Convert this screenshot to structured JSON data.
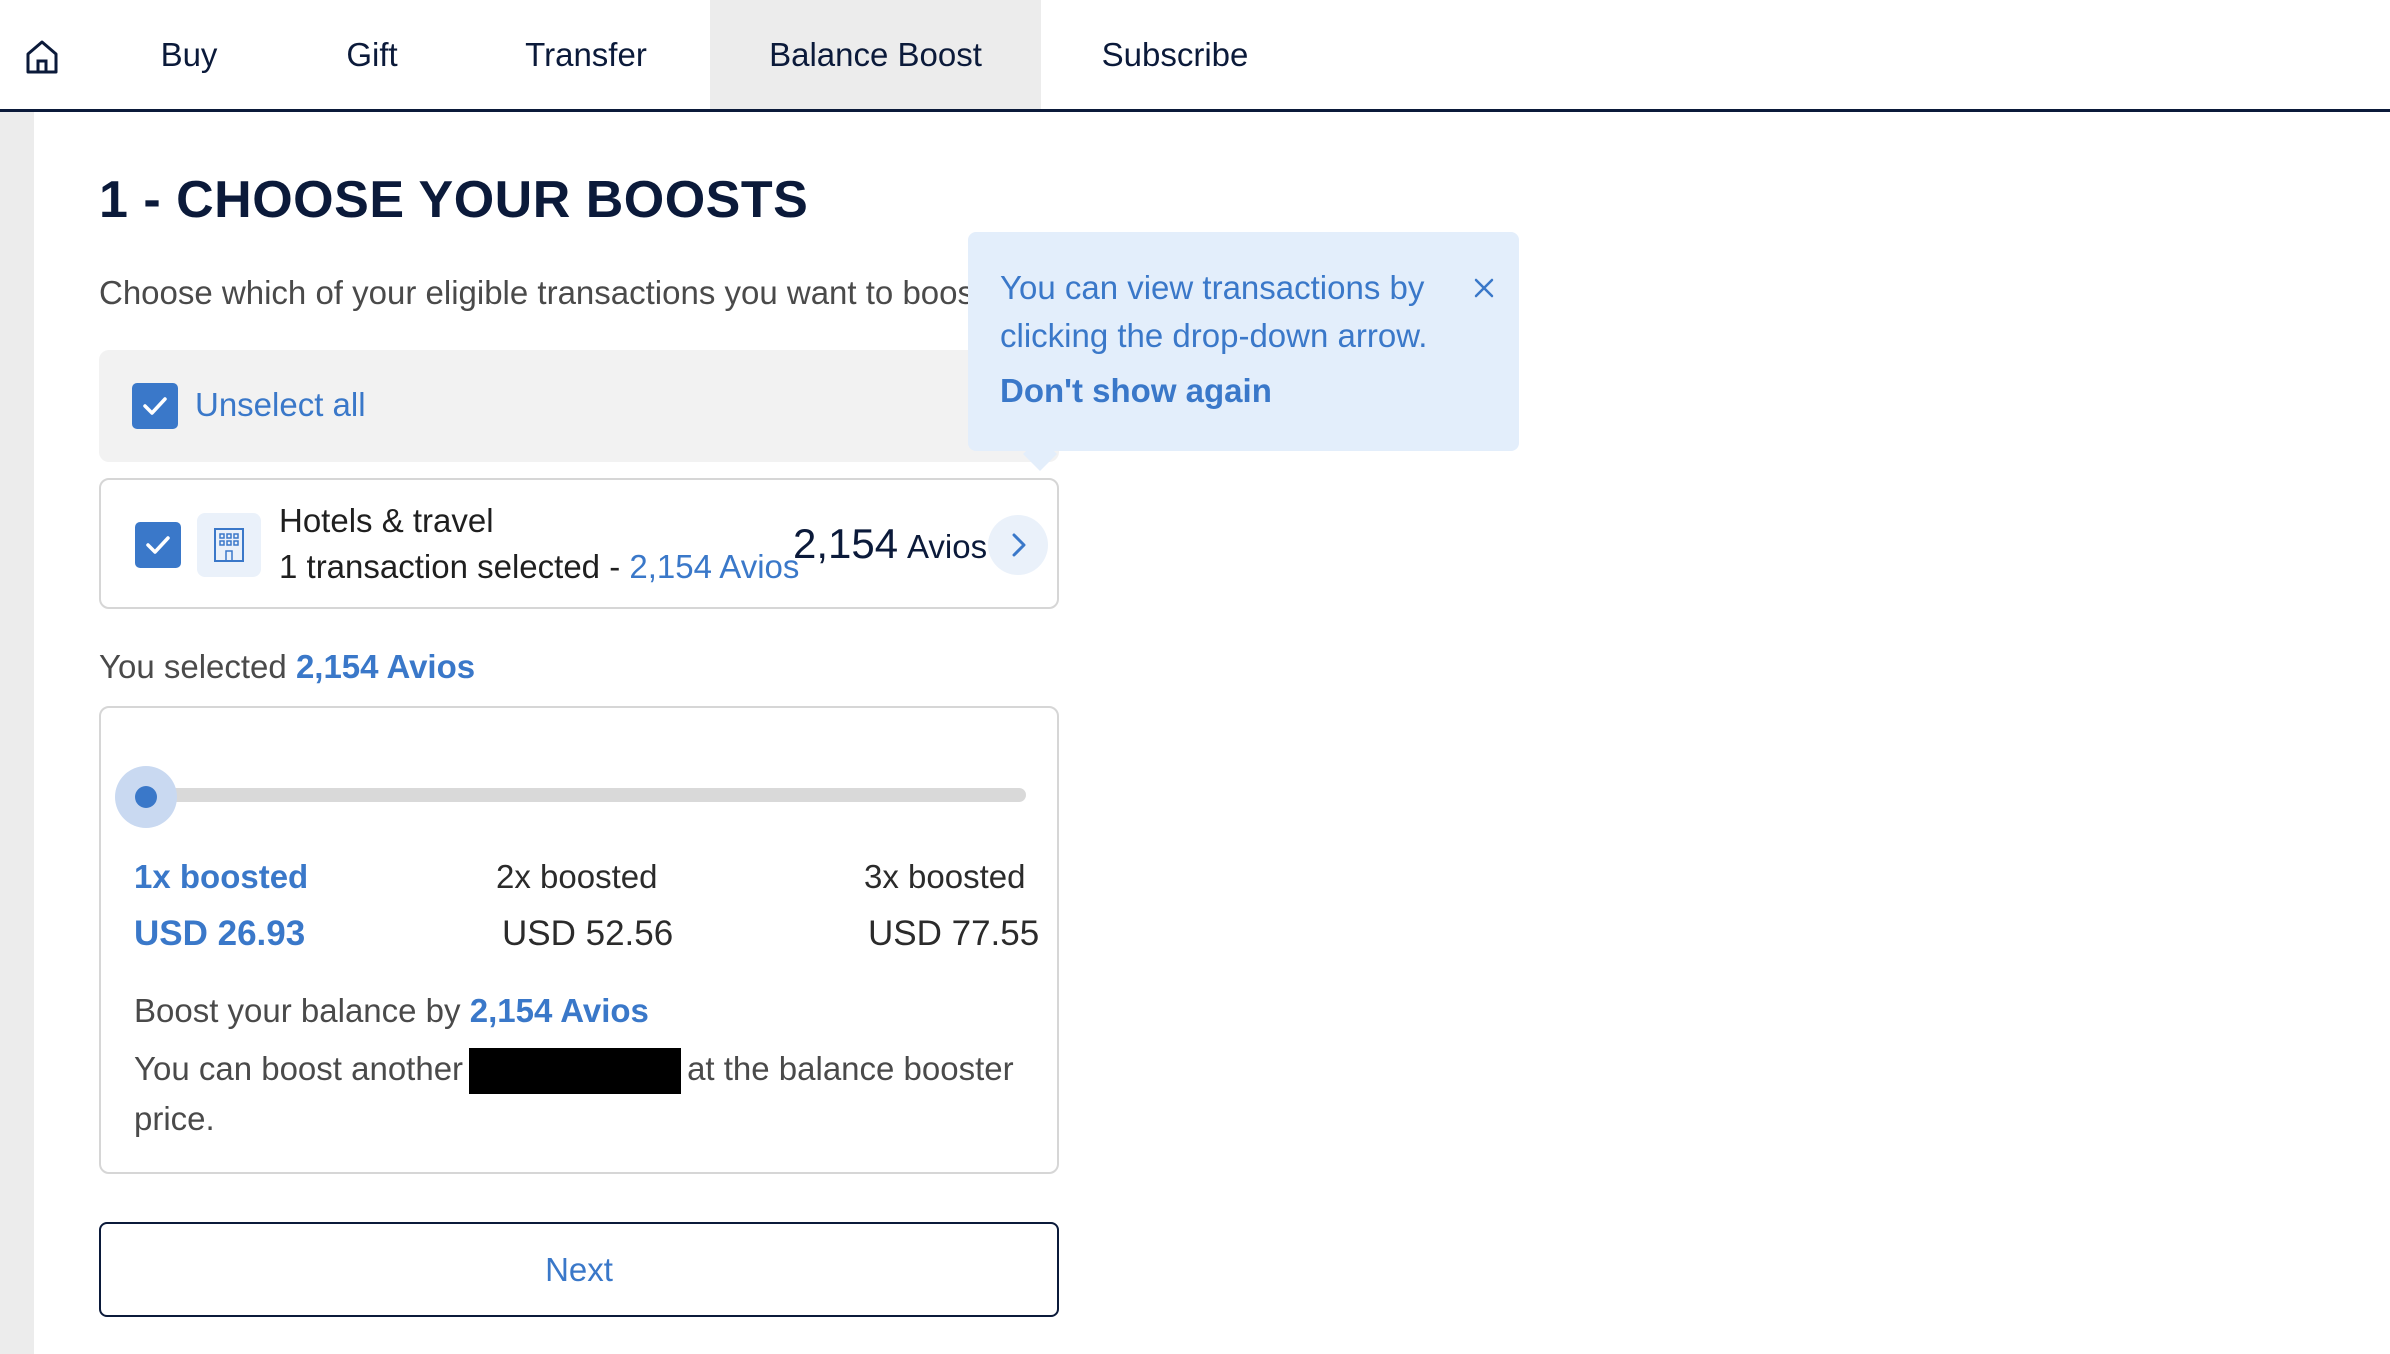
{
  "nav": {
    "home_icon": "home-icon",
    "tabs": [
      {
        "label": "Buy"
      },
      {
        "label": "Gift"
      },
      {
        "label": "Transfer"
      },
      {
        "label": "Balance Boost",
        "active": true
      },
      {
        "label": "Subscribe"
      }
    ]
  },
  "page": {
    "title": "1 - CHOOSE YOUR BOOSTS",
    "subtitle": "Choose which of your eligible transactions you want to boost"
  },
  "unselect_all": {
    "label": "Unselect all",
    "checked": true
  },
  "transactions": [
    {
      "category": "Hotels & travel",
      "icon": "hotel-building-icon",
      "detail_prefix": "1 transaction selected - ",
      "detail_avios": "2,154 Avios",
      "amount": "2,154",
      "unit": "Avios",
      "checked": true
    }
  ],
  "selection": {
    "prefix": "You selected ",
    "avios": "2,154 Avios"
  },
  "boost": {
    "slider_level_fraction": 0,
    "tiers": [
      {
        "label": "1x boosted",
        "price": "USD 26.93",
        "selected": true
      },
      {
        "label": "2x boosted",
        "price": "USD 52.56",
        "selected": false
      },
      {
        "label": "3x boosted",
        "price": "USD 77.55",
        "selected": false
      }
    ],
    "boost_by_prefix": "Boost your balance by ",
    "boost_by_avios": "2,154 Avios",
    "another_prefix": "You can boost another",
    "another_suffix": "at the balance booster price."
  },
  "next_button": {
    "label": "Next"
  },
  "tooltip": {
    "text": "You can view transactions by clicking the drop-down arrow.",
    "dismiss_label": "Don't show again",
    "close_icon": "close-icon"
  },
  "colors": {
    "accent": "#3a78c9",
    "navy": "#0b1a3a",
    "tooltip_bg": "#e3eefb"
  }
}
